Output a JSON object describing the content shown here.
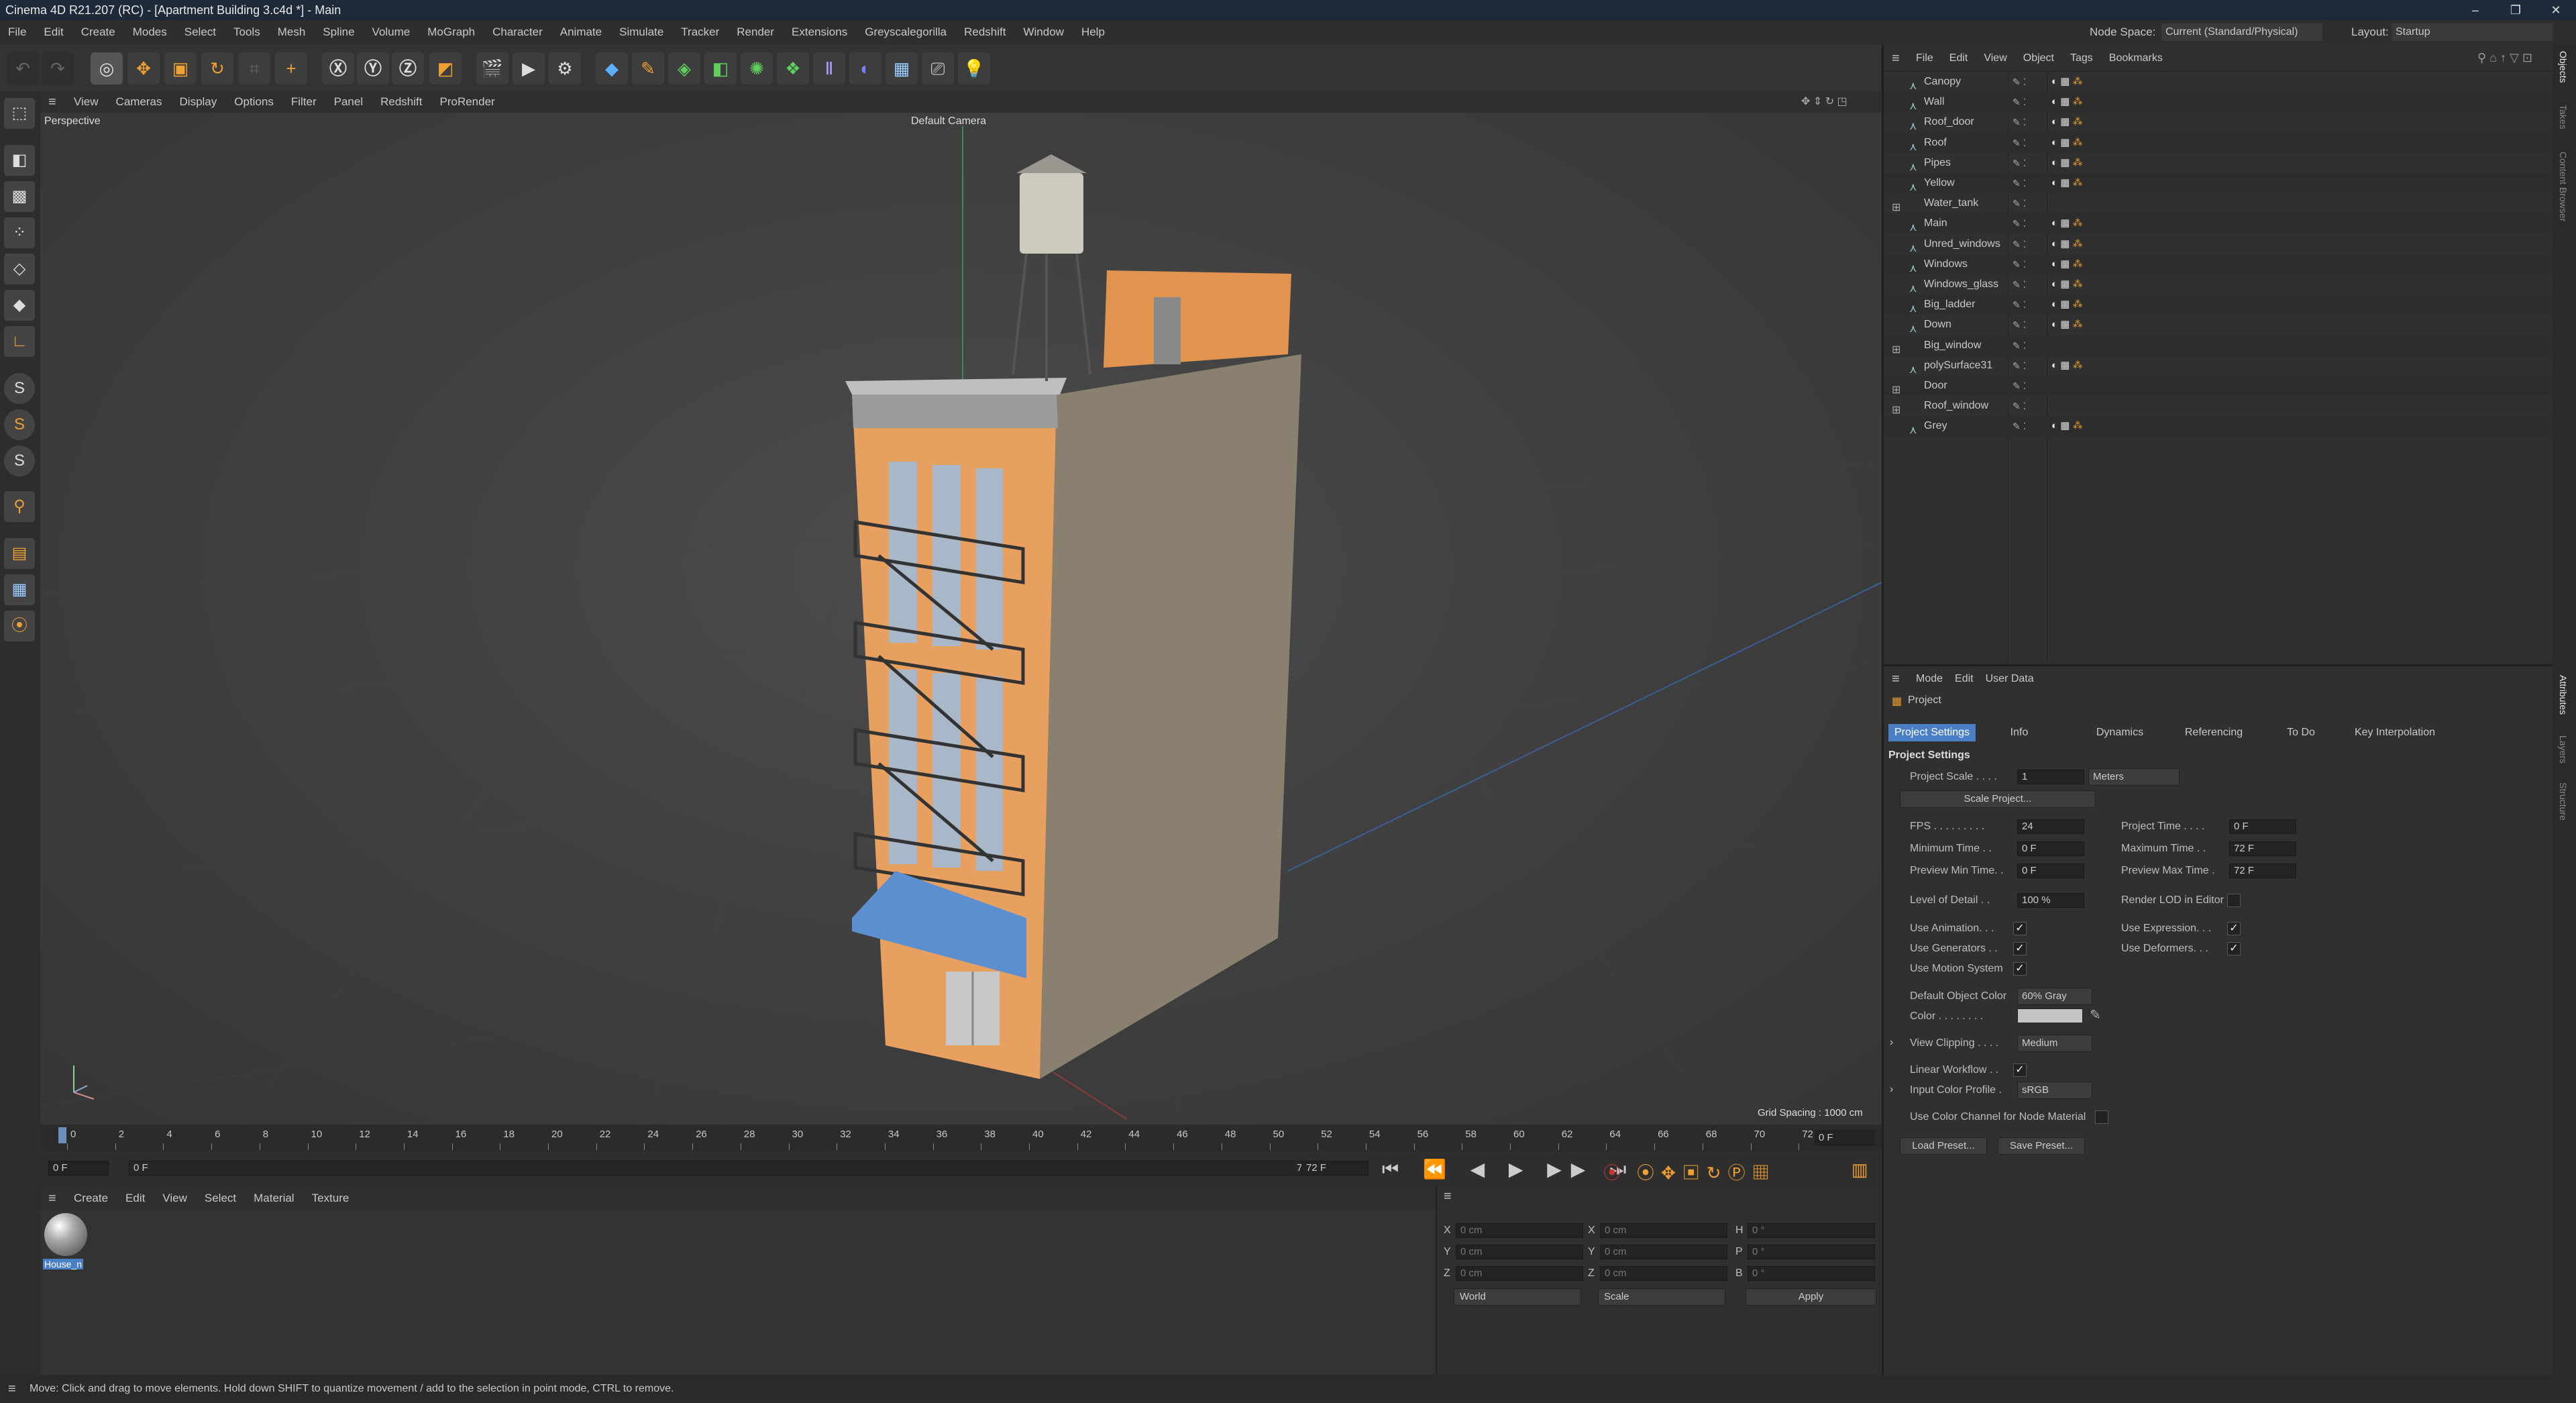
{
  "window": {
    "title": "Cinema 4D R21.207 (RC) - [Apartment Building 3.c4d *] - Main"
  },
  "menu": [
    "File",
    "Edit",
    "Create",
    "Modes",
    "Select",
    "Tools",
    "Mesh",
    "Spline",
    "Volume",
    "MoGraph",
    "Character",
    "Animate",
    "Simulate",
    "Tracker",
    "Render",
    "Extensions",
    "Greyscalegorilla",
    "Redshift",
    "Window",
    "Help"
  ],
  "node_space": {
    "label": "Node Space:",
    "value": "Current (Standard/Physical)"
  },
  "layout": {
    "label": "Layout:",
    "value": "Startup"
  },
  "viewport": {
    "menu": [
      "View",
      "Cameras",
      "Display",
      "Options",
      "Filter",
      "Panel",
      "Redshift",
      "ProRender"
    ],
    "label": "Perspective",
    "camera": "Default Camera",
    "grid_spacing": "Grid Spacing : 1000 cm"
  },
  "timeline": {
    "ticks": [
      "0",
      "2",
      "4",
      "6",
      "8",
      "10",
      "12",
      "14",
      "16",
      "18",
      "20",
      "22",
      "24",
      "26",
      "28",
      "30",
      "32",
      "34",
      "36",
      "38",
      "40",
      "42",
      "44",
      "46",
      "48",
      "50",
      "52",
      "54",
      "56",
      "58",
      "60",
      "62",
      "64",
      "66",
      "68",
      "70",
      "72"
    ],
    "current_frame": "0 F",
    "start": "0 F",
    "range_start": "0 F",
    "range_end": "72 F",
    "end": "72 F"
  },
  "material_menu": [
    "Create",
    "Edit",
    "View",
    "Select",
    "Material",
    "Texture"
  ],
  "material": {
    "name": "House_n"
  },
  "coords": {
    "rows": [
      {
        "a": "X",
        "av": "0 cm",
        "b": "X",
        "bv": "0 cm",
        "c": "H",
        "cv": "0 °"
      },
      {
        "a": "Y",
        "av": "0 cm",
        "b": "Y",
        "bv": "0 cm",
        "c": "P",
        "cv": "0 °"
      },
      {
        "a": "Z",
        "av": "0 cm",
        "b": "Z",
        "bv": "0 cm",
        "c": "B",
        "cv": "0 °"
      }
    ],
    "world": "World",
    "scale": "Scale",
    "apply": "Apply"
  },
  "status": "Move: Click and drag to move elements. Hold down SHIFT to quantize movement / add to the selection in point mode, CTRL to remove.",
  "objects": {
    "menu": [
      "File",
      "Edit",
      "View",
      "Object",
      "Tags",
      "Bookmarks"
    ],
    "items": [
      {
        "name": "Canopy",
        "group": false
      },
      {
        "name": "Wall",
        "group": false
      },
      {
        "name": "Roof_door",
        "group": false
      },
      {
        "name": "Roof",
        "group": false
      },
      {
        "name": "Pipes",
        "group": false
      },
      {
        "name": "Yellow",
        "group": false
      },
      {
        "name": "Water_tank",
        "group": true
      },
      {
        "name": "Main",
        "group": false
      },
      {
        "name": "Unred_windows",
        "group": false
      },
      {
        "name": "Windows",
        "group": false
      },
      {
        "name": "Windows_glass",
        "group": false
      },
      {
        "name": "Big_ladder",
        "group": false
      },
      {
        "name": "Down",
        "group": false
      },
      {
        "name": "Big_window",
        "group": true
      },
      {
        "name": "polySurface31",
        "group": false
      },
      {
        "name": "Door",
        "group": true
      },
      {
        "name": "Roof_window",
        "group": true
      },
      {
        "name": "Grey",
        "group": false
      }
    ]
  },
  "attributes": {
    "menu": [
      "Mode",
      "Edit",
      "User Data"
    ],
    "object": "Project",
    "tabs": [
      "Project Settings",
      "Info",
      "Dynamics",
      "Referencing",
      "To Do",
      "Key Interpolation"
    ],
    "section": "Project Settings",
    "project_scale": {
      "label": "Project Scale . . . .",
      "value": "1",
      "unit": "Meters"
    },
    "scale_project": "Scale Project...",
    "fps": {
      "label": "FPS . . . . . . . . .",
      "value": "24"
    },
    "project_time": {
      "label": "Project Time . . . .",
      "value": "0 F"
    },
    "min_time": {
      "label": "Minimum Time . .",
      "value": "0 F"
    },
    "max_time": {
      "label": "Maximum Time . .",
      "value": "72 F"
    },
    "preview_min": {
      "label": "Preview Min Time. .",
      "value": "0 F"
    },
    "preview_max": {
      "label": "Preview Max Time .",
      "value": "72 F"
    },
    "lod": {
      "label": "Level of Detail . .",
      "value": "100 %"
    },
    "render_lod": {
      "label": "Render LOD in Editor",
      "checked": false
    },
    "use_animation": {
      "label": "Use Animation. . .",
      "checked": true
    },
    "use_expression": {
      "label": "Use Expression. . .",
      "checked": true
    },
    "use_generators": {
      "label": "Use Generators . .",
      "checked": true
    },
    "use_deformers": {
      "label": "Use Deformers. . .",
      "checked": true
    },
    "use_motion": {
      "label": "Use Motion System",
      "checked": true
    },
    "default_color": {
      "label": "Default Object Color",
      "value": "60% Gray"
    },
    "color": {
      "label": "Color . . . . . . . ."
    },
    "view_clipping": {
      "label": "View Clipping . . . .",
      "value": "Medium"
    },
    "linear_workflow": {
      "label": "Linear Workflow . .",
      "checked": true
    },
    "input_profile": {
      "label": "Input Color Profile .",
      "value": "sRGB"
    },
    "color_channel": {
      "label": "Use Color Channel for Node Material",
      "checked": false
    },
    "load_preset": "Load Preset...",
    "save_preset": "Save Preset..."
  },
  "right_tabs": [
    "Objects",
    "Takes",
    "Content Browser",
    "Attributes",
    "Layers",
    "Structure"
  ],
  "colors": {
    "accent": "#4a7ec7",
    "building": "#e8a060",
    "awning": "#5c8fd0"
  }
}
